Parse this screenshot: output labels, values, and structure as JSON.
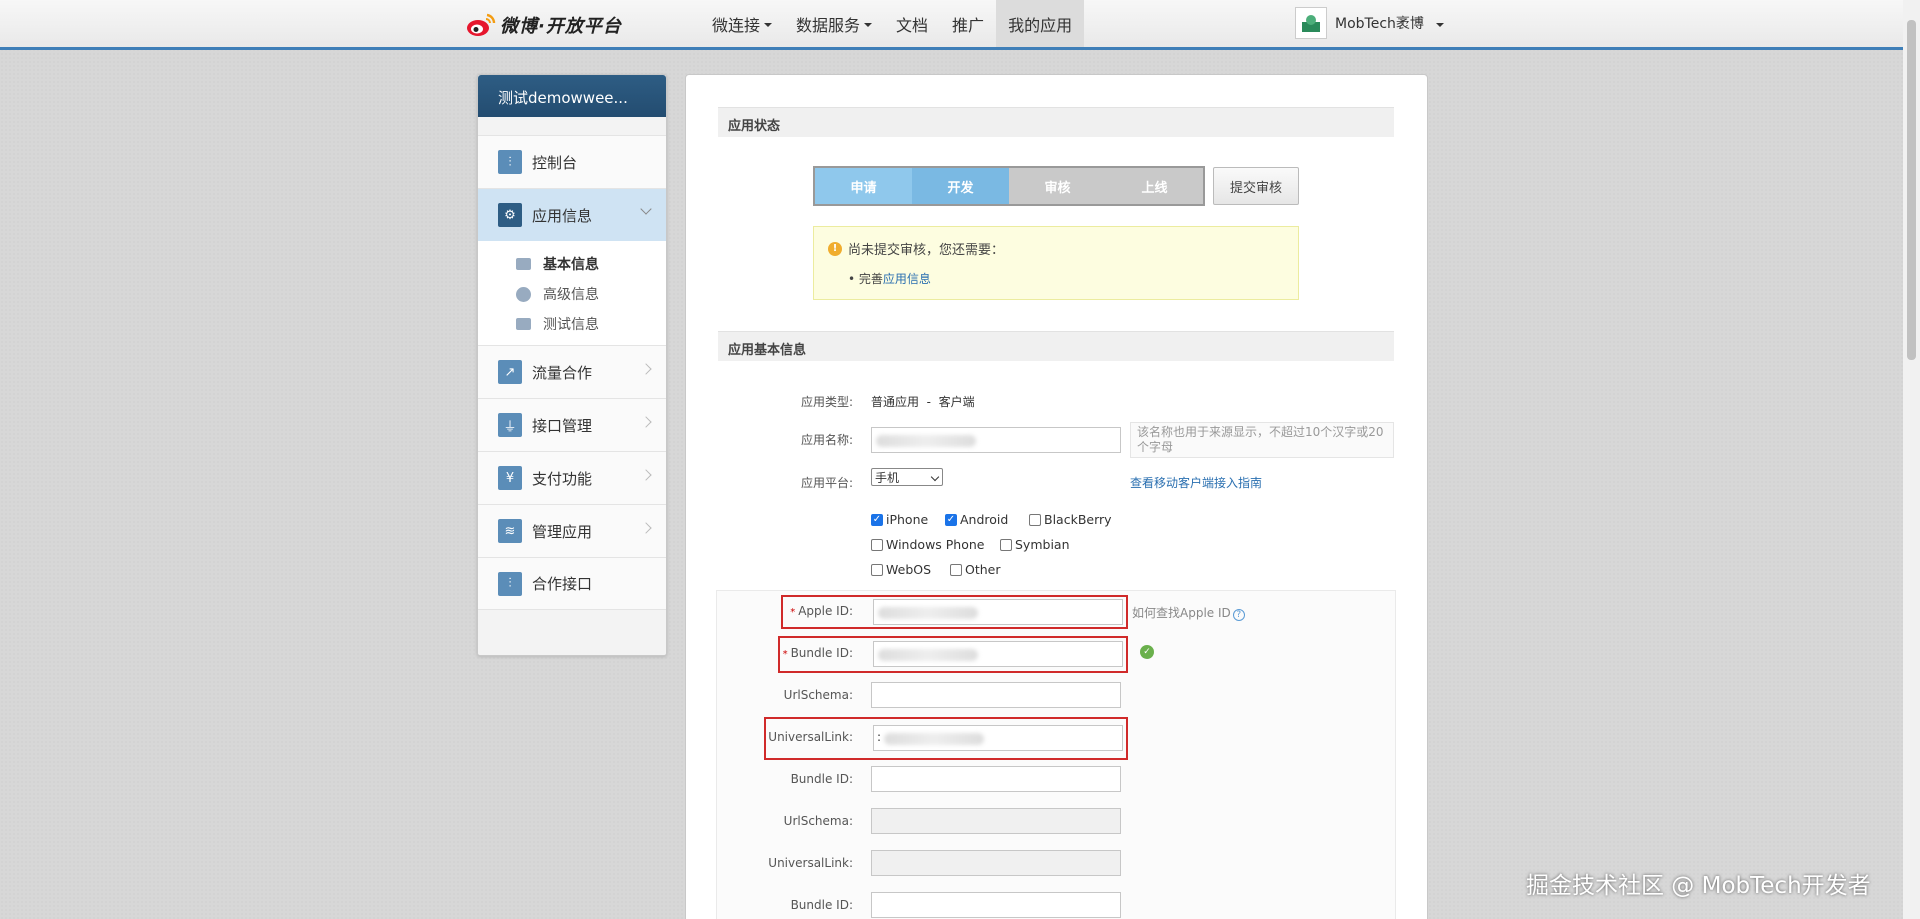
{
  "header": {
    "logo_text": "微博·开放平台",
    "nav": [
      {
        "label": "微连接",
        "caret": true
      },
      {
        "label": "数据服务",
        "caret": true
      },
      {
        "label": "文档",
        "caret": false
      },
      {
        "label": "推广",
        "caret": false
      },
      {
        "label": "我的应用",
        "caret": false
      }
    ],
    "user_name": "MobTech袤博"
  },
  "sidebar": {
    "app_name": "测试demowwee...",
    "items": [
      {
        "label": "控制台",
        "icon": "sliders-icon"
      },
      {
        "label": "应用信息",
        "icon": "gear-icon"
      },
      {
        "label": "流量合作",
        "icon": "chart-icon"
      },
      {
        "label": "接口管理",
        "icon": "plug-icon"
      },
      {
        "label": "支付功能",
        "icon": "yen-icon"
      },
      {
        "label": "管理应用",
        "icon": "layers-icon"
      },
      {
        "label": "合作接口",
        "icon": "sliders-icon"
      }
    ],
    "sub_items": [
      {
        "label": "基本信息",
        "icon": "id-card-icon"
      },
      {
        "label": "高级信息",
        "icon": "info-icon"
      },
      {
        "label": "测试信息",
        "icon": "image-card-icon"
      }
    ]
  },
  "status": {
    "title": "应用状态",
    "steps": [
      "申请",
      "开发",
      "审核",
      "上线"
    ],
    "submit_label": "提交审核",
    "notice_title": "尚未提交审核，您还需要：",
    "notice_prefix": "完善",
    "notice_link": "应用信息"
  },
  "basic": {
    "title": "应用基本信息",
    "type_label": "应用类型:",
    "type_value": "普通应用  -  客户端",
    "name_label": "应用名称:",
    "name_hint": "该名称也用于来源显示，不超过10个汉字或20个字母",
    "platform_label": "应用平台:",
    "platform_value": "手机",
    "guide_link": "查看移动客户端接入指南",
    "platforms": [
      {
        "label": "iPhone",
        "checked": true
      },
      {
        "label": "Android",
        "checked": true
      },
      {
        "label": "BlackBerry",
        "checked": false
      },
      {
        "label": "Windows Phone",
        "checked": false
      },
      {
        "label": "Symbian",
        "checked": false
      },
      {
        "label": "WebOS",
        "checked": false
      },
      {
        "label": "Other",
        "checked": false
      }
    ],
    "apple_id_label": "Apple ID:",
    "apple_id_help": "如何查找Apple ID",
    "bundle_id_label": "Bundle ID:",
    "urlschema_label": "UrlSchema:",
    "universal_link_label": "UniversalLink:",
    "universal_link_value": ":"
  },
  "watermark": "掘金技术社区 @ MobTech开发者",
  "colors": {
    "accent": "#3f7fb8",
    "sidebar_title": "#2e5d84",
    "highlight": "#d02a2a"
  }
}
